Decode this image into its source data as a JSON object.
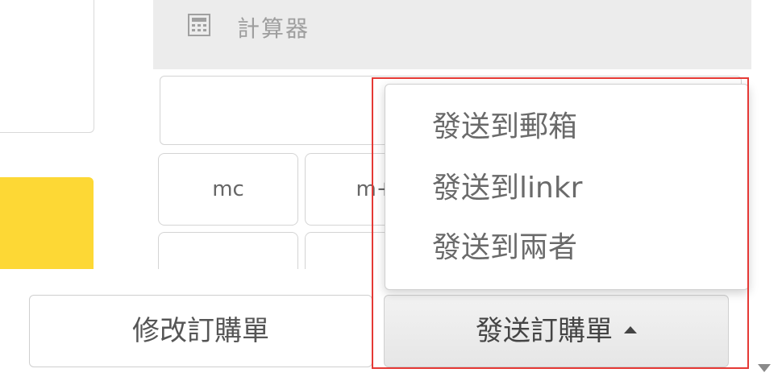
{
  "calculator": {
    "title": "計算器",
    "icon": "calculator-icon",
    "keys": [
      "mc",
      "m+"
    ]
  },
  "footer": {
    "edit_label": "修改訂購單",
    "send_label": "發送訂購單",
    "send_caret_icon": "caret-up-icon"
  },
  "send_menu": {
    "items": [
      "發送到郵箱",
      "發送到linkr",
      "發送到兩者"
    ]
  },
  "colors": {
    "highlight": "#e53935",
    "yellow_card": "#fdd835",
    "menu_text": "#6a6a6a"
  }
}
